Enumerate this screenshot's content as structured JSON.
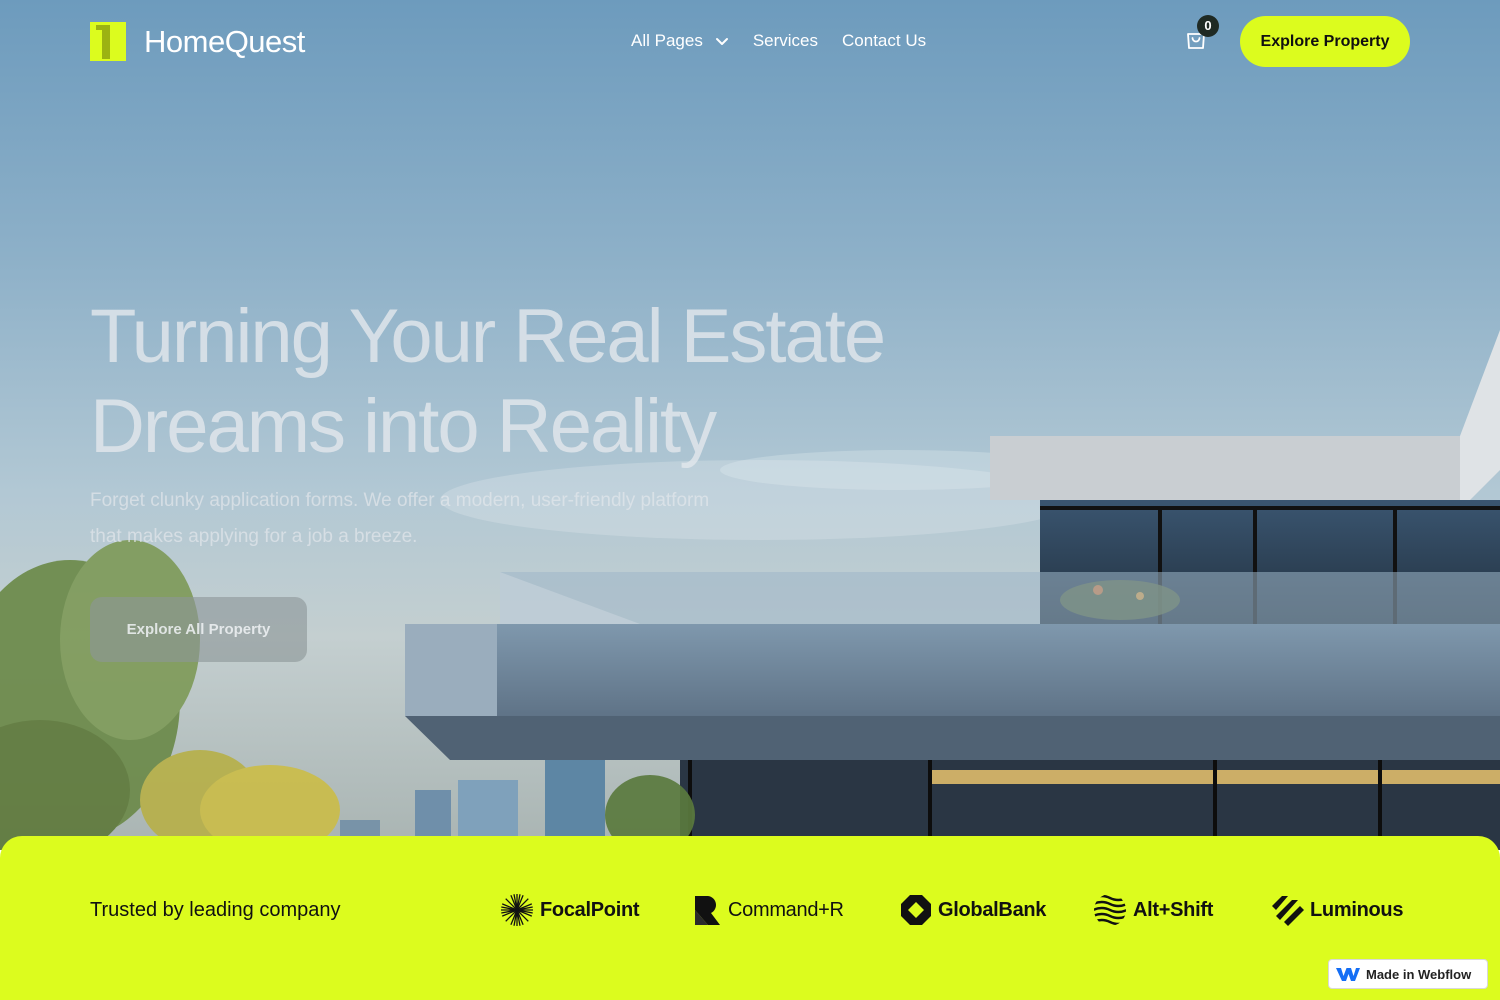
{
  "brand": {
    "name": "HomeQuest",
    "accent_color": "#DCFC1E"
  },
  "nav": {
    "items": [
      {
        "label": "All Pages",
        "icon": "chevron-down-icon"
      },
      {
        "label": "Services"
      },
      {
        "label": "Contact Us"
      }
    ],
    "cart": {
      "icon": "shopping-bag-icon",
      "count": "0"
    },
    "cta_label": "Explore Property"
  },
  "hero": {
    "title_lines": [
      "Turning Your Real Estate",
      "Dreams into Reality"
    ],
    "subtitle_lines": [
      "Forget clunky application forms. We offer a modern, user-friendly platform",
      "that makes applying for a job a breeze."
    ],
    "button_label": "Explore All Property"
  },
  "trusted": {
    "label": "Trusted by leading company",
    "brands": [
      {
        "name": "FocalPoint",
        "icon": "starburst-logo-icon"
      },
      {
        "name": "Command+R",
        "icon": "command-r-logo-icon"
      },
      {
        "name": "GlobalBank",
        "icon": "octagon-logo-icon"
      },
      {
        "name": "Alt+Shift",
        "icon": "wave-lines-logo-icon"
      },
      {
        "name": "Luminous",
        "icon": "slash-bars-logo-icon"
      }
    ]
  },
  "badge": {
    "label": "Made in Webflow",
    "icon": "webflow-logo-icon"
  }
}
